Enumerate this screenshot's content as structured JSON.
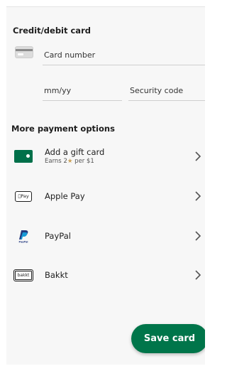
{
  "credit_card": {
    "title": "Credit/debit card",
    "card_icon": "credit-card-icon",
    "card_number_label": "Card number",
    "expiry_label": "mm/yy",
    "security_code_label": "Security code"
  },
  "more_options": {
    "title": "More payment options",
    "items": [
      {
        "label": "Add a gift card",
        "sub_prefix": "Earns 2",
        "sub_star": "★",
        "sub_suffix": " per $1",
        "icon": "gift-card-icon"
      },
      {
        "label": "Apple Pay",
        "logo_text": "Pay",
        "icon": "apple-pay-icon"
      },
      {
        "label": "PayPal",
        "icon": "paypal-icon"
      },
      {
        "label": "Bakkt",
        "logo_text": "bakkt",
        "icon": "bakkt-icon"
      }
    ]
  },
  "save_button": {
    "label": "Save card"
  },
  "colors": {
    "brand_green": "#00754a",
    "gift_card_green": "#00704a",
    "star_gold": "#cba258",
    "background": "#f7f7f7"
  }
}
